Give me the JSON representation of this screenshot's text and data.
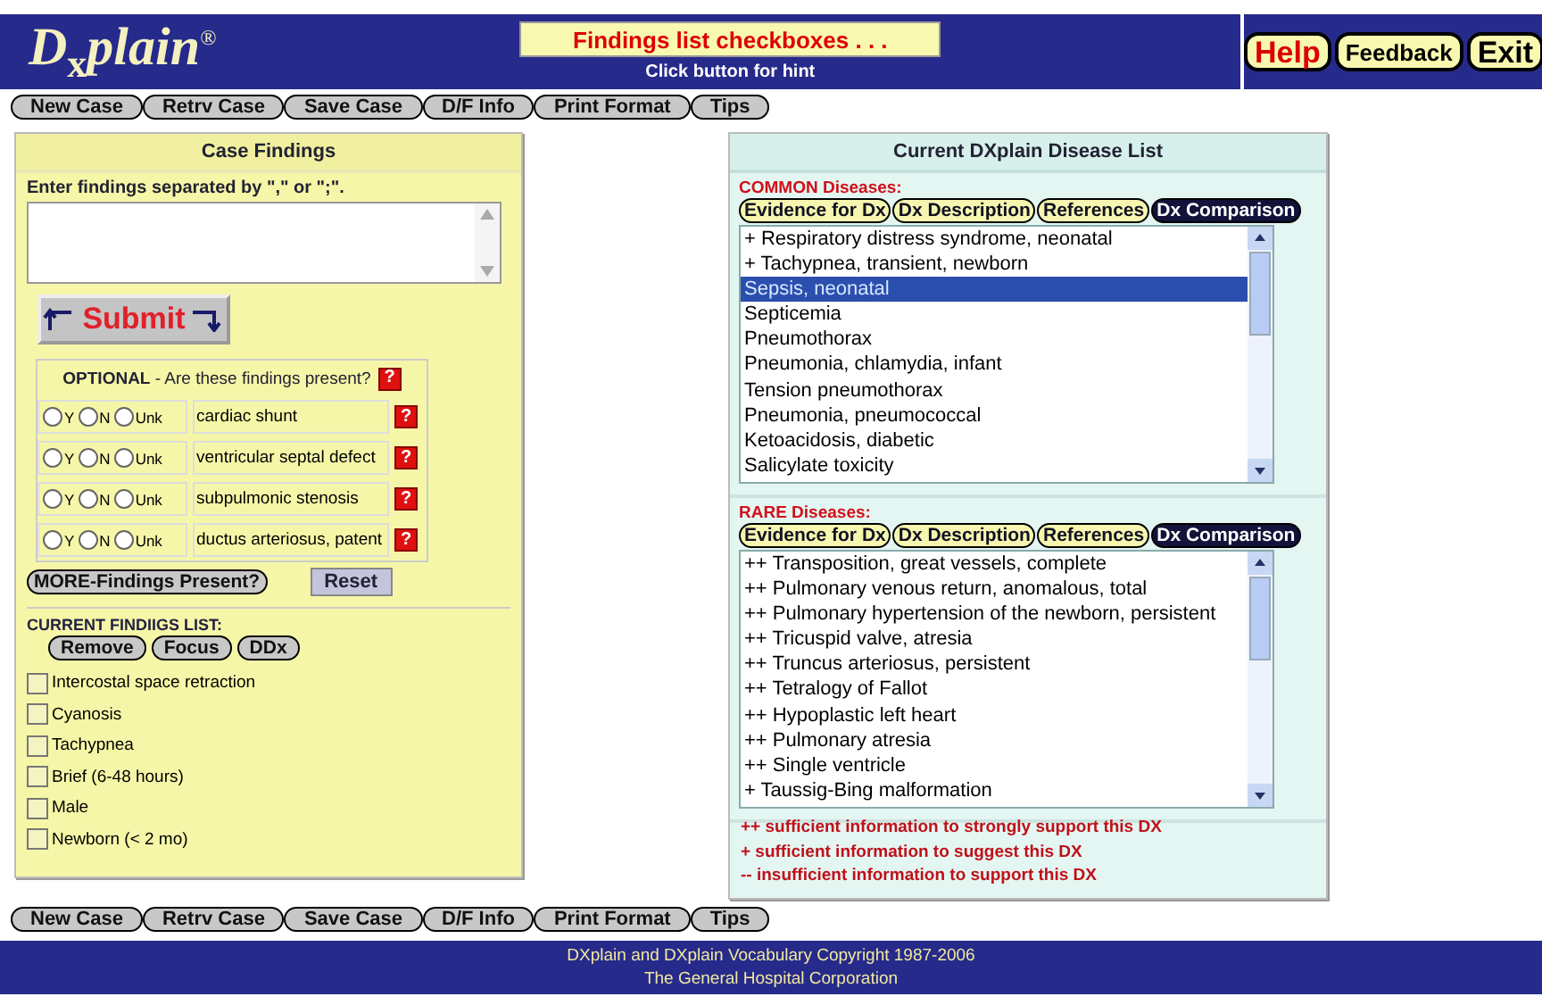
{
  "header": {
    "logo": "D$_{x}$plain$^{®}$",
    "hint_title": "Findings list checkboxes . . .",
    "hint_subtitle": "Click button for hint",
    "actions": [
      {
        "label": "Help",
        "kind": "big"
      },
      {
        "label": "Feedback",
        "kind": "small"
      },
      {
        "label": "Exit",
        "kind": "big"
      }
    ]
  },
  "nav_top": [
    "New Case",
    "Retrv Case",
    "Save Case",
    "D/F Info",
    "Print Format",
    "Tips"
  ],
  "case_findings": {
    "title": "Case Findings",
    "prompt": "Enter findings separated by \",\" or \";\".",
    "submit": "Submit",
    "optional": {
      "heading": "**OPTIONAL** - Are these findings present?",
      "help": "?",
      "rows": [
        {
          "finding": "cardiac shunt",
          "help": "?",
          "options": [
            {
              "label": "Y",
              "selected": false
            },
            {
              "label": "N",
              "selected": false
            },
            {
              "label": "Unk",
              "selected": false
            }
          ]
        },
        {
          "finding": "ventricular septal defect",
          "help": "?",
          "options": [
            {
              "label": "Y",
              "selected": false
            },
            {
              "label": "N",
              "selected": false
            },
            {
              "label": "Unk",
              "selected": false
            }
          ]
        },
        {
          "finding": "subpulmonic stenosis",
          "help": "?",
          "options": [
            {
              "label": "Y",
              "selected": false
            },
            {
              "label": "N",
              "selected": false
            },
            {
              "label": "Unk",
              "selected": false
            }
          ]
        },
        {
          "finding": "ductus arteriosus, patent",
          "help": "?",
          "options": [
            {
              "label": "Y",
              "selected": false
            },
            {
              "label": "N",
              "selected": false
            },
            {
              "label": "Unk",
              "selected": false
            }
          ]
        }
      ]
    },
    "more": "MORE-Findings Present?",
    "reset": "Reset",
    "list_title": "CURRENT FINDIIGS LIST:",
    "list_buttons": [
      "Remove",
      "Focus",
      "DDx"
    ],
    "findings": [
      {
        "label": "Intercostal space retraction",
        "checked": false
      },
      {
        "label": "Cyanosis",
        "checked": false
      },
      {
        "label": "Tachypnea",
        "checked": false
      },
      {
        "label": "Brief (6-48 hours)",
        "checked": false
      },
      {
        "label": "Male",
        "checked": false
      },
      {
        "label": "Newborn (< 2 mo)",
        "checked": false
      }
    ]
  },
  "disease_list": {
    "title": "Current DXplain Disease List",
    "sections": [
      {
        "heading": "COMMON Diseases:",
        "buttons": [
          {
            "label": "Evidence for Dx",
            "selected": false
          },
          {
            "label": "Dx Description",
            "selected": false
          },
          {
            "label": "References",
            "selected": false
          },
          {
            "label": "Dx Comparison",
            "selected": true
          }
        ],
        "items": [
          {
            "label": "+ Respiratory distress syndrome, neonatal",
            "selected": false
          },
          {
            "label": "+ Tachypnea, transient, newborn",
            "selected": false
          },
          {
            "label": "Sepsis, neonatal",
            "selected": true
          },
          {
            "label": "Septicemia",
            "selected": false
          },
          {
            "label": "Pneumothorax",
            "selected": false
          },
          {
            "label": "Pneumonia, chlamydia, infant",
            "selected": false
          },
          {
            "label": "Tension pneumothorax",
            "selected": false
          },
          {
            "label": "Pneumonia, pneumococcal",
            "selected": false
          },
          {
            "label": "Ketoacidosis, diabetic",
            "selected": false
          },
          {
            "label": "Salicylate toxicity",
            "selected": false
          }
        ]
      },
      {
        "heading": "RARE Diseases:",
        "buttons": [
          {
            "label": "Evidence for Dx",
            "selected": false
          },
          {
            "label": "Dx Description",
            "selected": false
          },
          {
            "label": "References",
            "selected": false
          },
          {
            "label": "Dx Comparison",
            "selected": true
          }
        ],
        "items": [
          {
            "label": "++ Transposition, great vessels, complete",
            "selected": false
          },
          {
            "label": "++ Pulmonary venous return, anomalous, total",
            "selected": false
          },
          {
            "label": "++ Pulmonary hypertension of the newborn, persistent",
            "selected": false
          },
          {
            "label": "++ Tricuspid valve, atresia",
            "selected": false
          },
          {
            "label": "++ Truncus arteriosus, persistent",
            "selected": false
          },
          {
            "label": "++ Tetralogy of Fallot",
            "selected": false
          },
          {
            "label": "++ Hypoplastic left heart",
            "selected": false
          },
          {
            "label": "++ Pulmonary atresia",
            "selected": false
          },
          {
            "label": "++ Single ventricle",
            "selected": false
          },
          {
            "label": "+ Taussig-Bing malformation",
            "selected": false
          }
        ]
      }
    ],
    "legend": [
      "++ sufficient information to strongly support this DX",
      "+ sufficient information to suggest this DX",
      "-- insufficient information to support this DX"
    ]
  },
  "nav_bottom": [
    "New Case",
    "Retrv Case",
    "Save Case",
    "D/F Info",
    "Print Format",
    "Tips"
  ],
  "footer": [
    "DXplain and DXplain Vocabulary Copyright 1987-2006",
    "The General Hospital Corporation"
  ]
}
